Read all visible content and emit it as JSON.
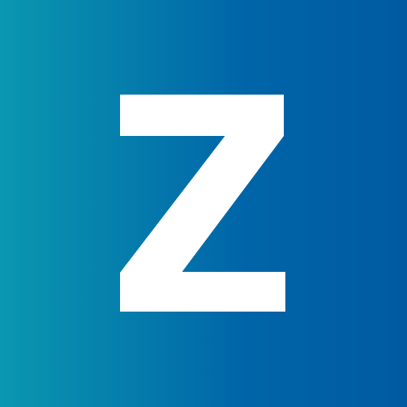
{
  "logo": {
    "letter": "Z",
    "glyph_color": "#ffffff",
    "gradient_start": "#0a97b0",
    "gradient_end": "#005aa2"
  }
}
